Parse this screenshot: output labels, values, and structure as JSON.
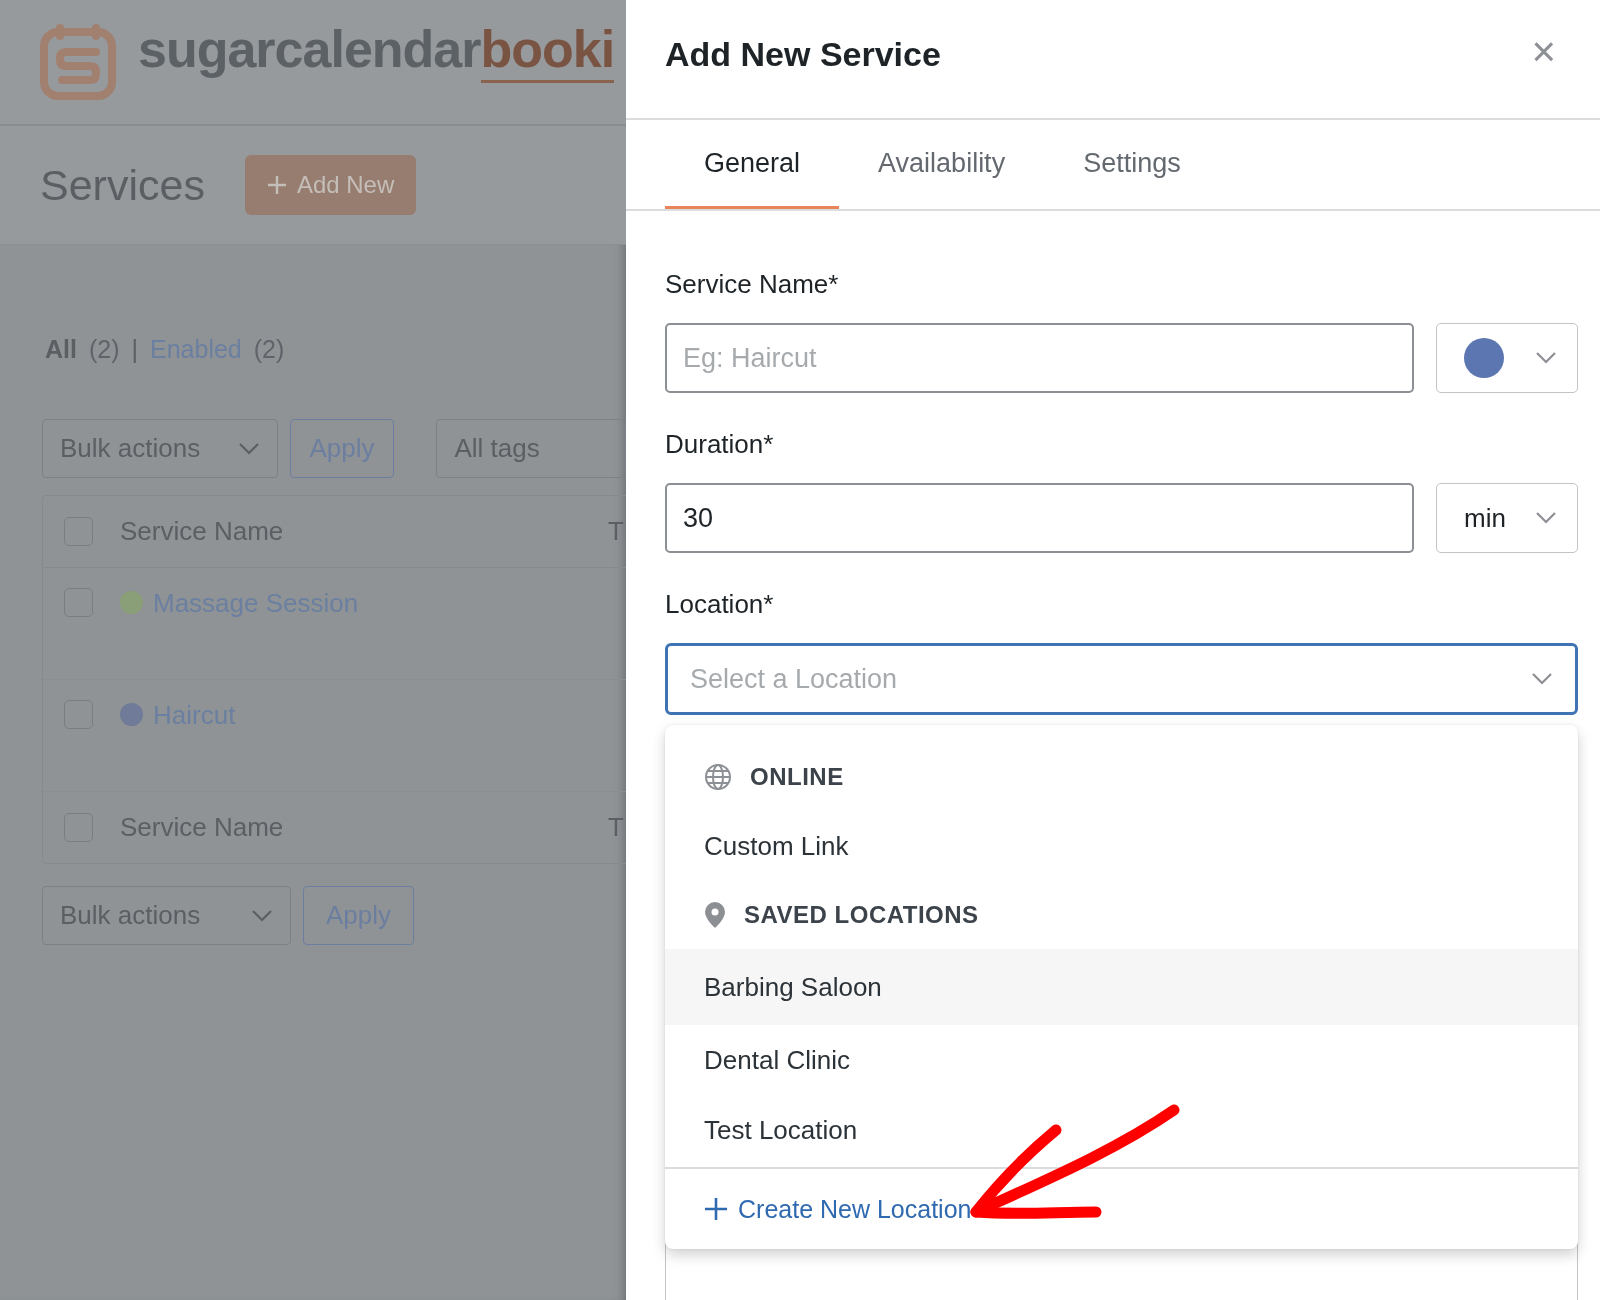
{
  "background_page": {
    "logo": {
      "word": "sugarcalendar",
      "accent": "booki"
    },
    "title": "Services",
    "add_button": "Add New",
    "filters": [
      {
        "label": "All",
        "count": "(2)",
        "selected": true
      },
      {
        "label": "Enabled",
        "count": "(2)",
        "selected": false
      }
    ],
    "filter_separator": "|",
    "top_bulk_actions": {
      "label": "Bulk actions",
      "apply": "Apply"
    },
    "tags_filter": "All tags",
    "table": {
      "columns": [
        "Service Name",
        "T"
      ],
      "header_checked": false,
      "rows": [
        {
          "name": "Massage Session",
          "color": "#8a9f78",
          "checked": false
        },
        {
          "name": "Haircut",
          "color": "#6f7b99",
          "checked": false
        }
      ],
      "footer_columns": [
        "Service Name",
        "T"
      ],
      "footer_checked": false
    },
    "bottom_bulk_actions": {
      "label": "Bulk actions",
      "apply": "Apply"
    }
  },
  "panel": {
    "title": "Add New Service",
    "close": "×",
    "tabs": [
      {
        "label": "General",
        "selected": true
      },
      {
        "label": "Availability",
        "selected": false
      },
      {
        "label": "Settings",
        "selected": false
      }
    ],
    "service_name": {
      "label": "Service Name*",
      "placeholder": "Eg: Haircut",
      "color": "#5b76b0"
    },
    "duration": {
      "label": "Duration*",
      "value": "30",
      "unit": "min"
    },
    "location": {
      "label": "Location*",
      "placeholder": "Select a Location",
      "focused": true
    },
    "dropdown": {
      "groups": [
        {
          "label": "ONLINE",
          "options": [
            {
              "label": "Custom Link",
              "highlighted": false
            }
          ]
        },
        {
          "label": "SAVED LOCATIONS",
          "options": [
            {
              "label": "Barbing Saloon",
              "highlighted": true
            },
            {
              "label": "Dental Clinic",
              "highlighted": false
            },
            {
              "label": "Test Location",
              "highlighted": false
            }
          ]
        }
      ],
      "create_link": "Create New Location"
    }
  }
}
